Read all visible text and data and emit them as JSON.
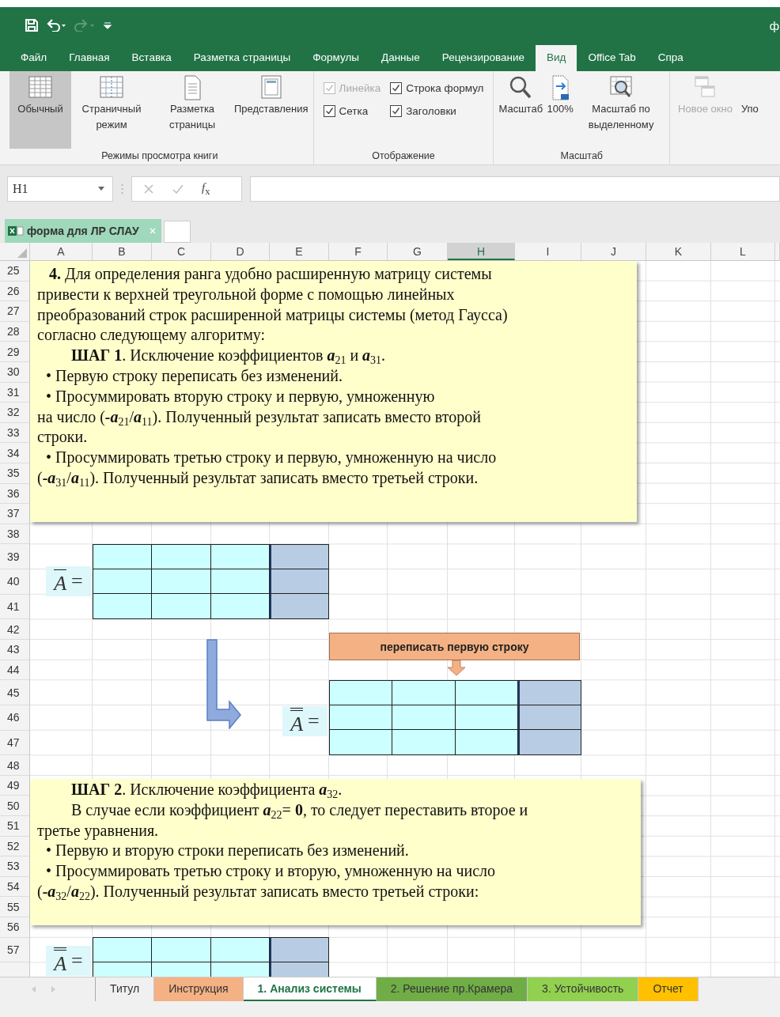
{
  "title_bar": {
    "title": "ф",
    "quick_access": [
      {
        "kind": "save",
        "disabled": false
      },
      {
        "kind": "undo",
        "disabled": false
      },
      {
        "kind": "redo",
        "disabled": true
      },
      {
        "kind": "customize",
        "disabled": false
      }
    ]
  },
  "ribbon_tabs": [
    {
      "label": "Файл",
      "selected": false
    },
    {
      "label": "Главная",
      "selected": false
    },
    {
      "label": "Вставка",
      "selected": false
    },
    {
      "label": "Разметка страницы",
      "selected": false
    },
    {
      "label": "Формулы",
      "selected": false
    },
    {
      "label": "Данные",
      "selected": false
    },
    {
      "label": "Рецензирование",
      "selected": false
    },
    {
      "label": "Вид",
      "selected": true
    },
    {
      "label": "Office Tab",
      "selected": false
    },
    {
      "label": "Спра",
      "selected": false
    }
  ],
  "ribbon_groups": [
    {
      "kind": "buttons",
      "label": "Режимы просмотра книги",
      "items": [
        {
          "kind": "normal",
          "label": "Обычный",
          "selected": true,
          "disabled": false
        },
        {
          "kind": "pagebreak",
          "label": "Страничный режим",
          "selected": false,
          "disabled": false
        },
        {
          "kind": "pagelayout",
          "label": "Разметка страницы",
          "selected": false,
          "disabled": false
        },
        {
          "kind": "views",
          "label": "Представления",
          "selected": false,
          "disabled": false
        }
      ]
    },
    {
      "kind": "checkboxes",
      "label": "Отображение",
      "items": [
        {
          "label": "Линейка",
          "checked": true,
          "disabled": true
        },
        {
          "label": "Строка формул",
          "checked": true,
          "disabled": false
        },
        {
          "label": "Сетка",
          "checked": true,
          "disabled": false
        },
        {
          "label": "Заголовки",
          "checked": true,
          "disabled": false
        }
      ]
    },
    {
      "kind": "buttons",
      "label": "Масштаб",
      "items": [
        {
          "kind": "zoom",
          "label": "Масштаб",
          "selected": false,
          "disabled": false
        },
        {
          "kind": "zoom100",
          "label": "100%",
          "selected": false,
          "disabled": false
        },
        {
          "kind": "zoomsel",
          "label": "Масштаб по выделенному",
          "selected": false,
          "disabled": false
        }
      ]
    },
    {
      "kind": "buttons",
      "items": [
        {
          "kind": "newwindow",
          "label": "Новое окно",
          "selected": false,
          "disabled": true
        },
        {
          "kind": "cut",
          "label": "Упо",
          "selected": false,
          "disabled": false
        }
      ]
    }
  ],
  "formula_bar": {
    "name_box": "H1",
    "function_label": "*f*$_{x}$"
  },
  "doc_tabs": [
    {
      "label": "форма для ЛР СЛАУ",
      "selected": true
    }
  ],
  "sheet": {
    "columns": [
      {
        "label": "A",
        "selected": false
      },
      {
        "label": "B",
        "selected": false
      },
      {
        "label": "C",
        "selected": false
      },
      {
        "label": "D",
        "selected": false
      },
      {
        "label": "E",
        "selected": false
      },
      {
        "label": "F",
        "selected": false
      },
      {
        "label": "G",
        "selected": false
      },
      {
        "label": "H",
        "selected": true
      },
      {
        "label": "I",
        "selected": false
      },
      {
        "label": "J",
        "selected": false
      },
      {
        "label": "K",
        "selected": false
      },
      {
        "label": "L",
        "selected": false
      }
    ],
    "rows": [
      "25",
      "26",
      "27",
      "28",
      "29",
      "30",
      "31",
      "32",
      "33",
      "34",
      "35",
      "36",
      "37",
      "38",
      "39",
      "40",
      "41",
      "42",
      "43",
      "44",
      "45",
      "46",
      "47",
      "48",
      "49",
      "50",
      "51",
      "52",
      "53",
      "54",
      "55",
      "56",
      "57"
    ],
    "text_boxes": [
      {
        "lines": [
          {
            "kind": "indent",
            "text": "**4.** Для определения ранга удобно расширенную матрицу системы"
          },
          {
            "kind": "plain",
            "text": "привести к верхней треугольной форме с помощью линейных"
          },
          {
            "kind": "plain",
            "text": "преобразований строк расширенной матрицы системы (метод  Гаусса)"
          },
          {
            "kind": "plain",
            "text": "согласно следующему алгоритму:"
          },
          {
            "kind": "step",
            "text": "**ШАГ 1**. Исключение коэффициентов *a*$_{21}$ и *a*$_{31}$."
          },
          {
            "kind": "bullet",
            "text": "• Первую строку переписать без изменений."
          },
          {
            "kind": "bullet",
            "text": "• Просуммировать вторую строку и первую, умноженную"
          },
          {
            "kind": "plain",
            "text": "на число (*-a*$_{21}$/*a*$_{11}$). Полученный результат записать вместо второй"
          },
          {
            "kind": "plain",
            "text": "строки."
          },
          {
            "kind": "bullet",
            "text": "• Просуммировать третью строку и первую, умноженную на число"
          },
          {
            "kind": "plain",
            "text": "(*-a*$_{31}$/*a*$_{11}$). Полученный результат записать вместо третьей строки."
          }
        ]
      },
      {
        "lines": [
          {
            "kind": "step",
            "text": "**ШАГ 2**. Исключение коэффициента *a*$_{32}$."
          },
          {
            "kind": "step",
            "text": "В случае если коэффициент *a*$_{22}$= **0**, то следует переставить второе и"
          },
          {
            "kind": "plain",
            "text": "третье уравнения."
          },
          {
            "kind": "bullet",
            "text": "• Первую и вторую строки переписать без изменений."
          },
          {
            "kind": "bullet",
            "text": "• Просуммировать третью строку и вторую, умноженную на число"
          },
          {
            "kind": "plain",
            "text": "(*-a*$_{32}$/*a*$_{22}$). Полученный результат записать вместо третьей строки:"
          }
        ]
      }
    ],
    "matrices": [
      {
        "kind": "single",
        "symbol": "A",
        "sign": "="
      },
      {
        "kind": "double",
        "symbol": "A",
        "sign": "="
      },
      {
        "kind": "double",
        "symbol": "A",
        "sign": "="
      }
    ],
    "callout": {
      "text": "переписать первую строку"
    }
  },
  "sheet_tabs": [
    {
      "label": "Титул",
      "selected": false
    },
    {
      "label": "Инструкция",
      "selected": false,
      "color": "#f4b183"
    },
    {
      "label": "1. Анализ системы",
      "selected": true
    },
    {
      "label": "2. Решение пр.Крамера",
      "selected": false,
      "color": "#70ad47"
    },
    {
      "label": "3. Устойчивость",
      "selected": false,
      "color": "#92d050"
    },
    {
      "label": "Отчет",
      "selected": false,
      "color": "#ffc000"
    }
  ]
}
